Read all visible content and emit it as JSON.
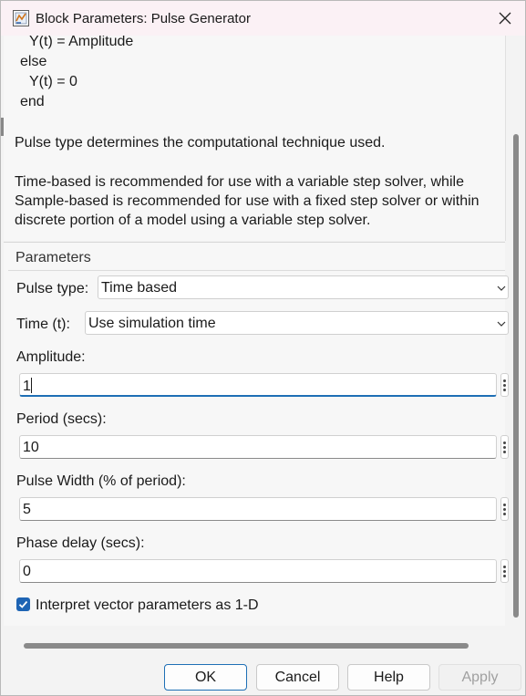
{
  "window": {
    "title": "Block Parameters: Pulse Generator"
  },
  "description": {
    "code_lines": [
      "Y(t) = Amplitude",
      "else",
      "Y(t) = 0",
      "end"
    ],
    "paragraph1": "Pulse type determines the computational technique used.",
    "paragraph2": "Time-based is recommended for use with a variable step solver, while Sample-based is recommended for use with a fixed step solver or within discrete portion of a model using a variable step solver."
  },
  "parameters": {
    "section_label": "Parameters",
    "pulse_type": {
      "label": "Pulse type:",
      "value": "Time based"
    },
    "time": {
      "label": "Time (t):",
      "value": "Use simulation time"
    },
    "amplitude": {
      "label": "Amplitude:",
      "value": "1"
    },
    "period": {
      "label": "Period (secs):",
      "value": "10"
    },
    "pulse_width": {
      "label": "Pulse Width (% of period):",
      "value": "5"
    },
    "phase_delay": {
      "label": "Phase delay (secs):",
      "value": "0"
    },
    "interpret_vector": {
      "label": "Interpret vector parameters as 1-D",
      "checked": true
    }
  },
  "buttons": {
    "ok": "OK",
    "cancel": "Cancel",
    "help": "Help",
    "apply": "Apply"
  },
  "colors": {
    "accent": "#1e6fb5",
    "checkbox": "#1e64b4",
    "titlebar": "#fbf1f5"
  }
}
